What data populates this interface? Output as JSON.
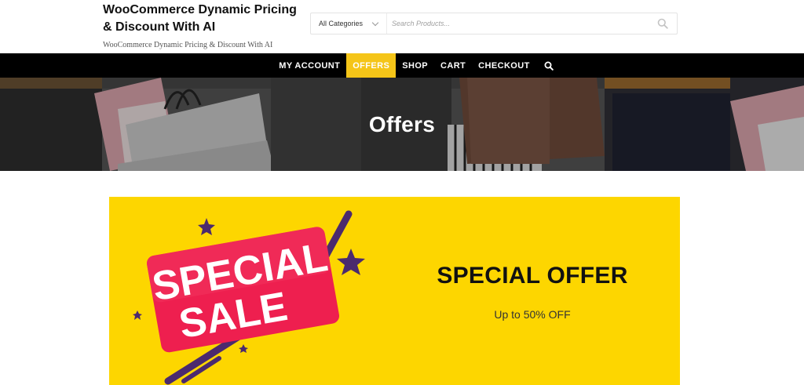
{
  "header": {
    "site_title": "WooCommerce Dynamic Pricing & Discount With AI",
    "site_tagline": "WooCommerce Dynamic Pricing & Discount With AI",
    "category_select": "All Categories",
    "search_placeholder": "Search Products..."
  },
  "nav": {
    "items": [
      {
        "label": "MY ACCOUNT"
      },
      {
        "label": "OFFERS",
        "active": true
      },
      {
        "label": "SHOP"
      },
      {
        "label": "CART"
      },
      {
        "label": "CHECKOUT"
      }
    ],
    "active_color": "#f5c518",
    "search_icon": "search-icon"
  },
  "hero": {
    "title": "Offers"
  },
  "banner": {
    "badge_line1": "SPECIAL",
    "badge_line2": "SALE",
    "heading": "SPECIAL OFFER",
    "subheading": "Up to 50% OFF",
    "background_color": "#fdd600",
    "badge_color": "#ee1f4f",
    "accent_color": "#4b2a6e"
  }
}
